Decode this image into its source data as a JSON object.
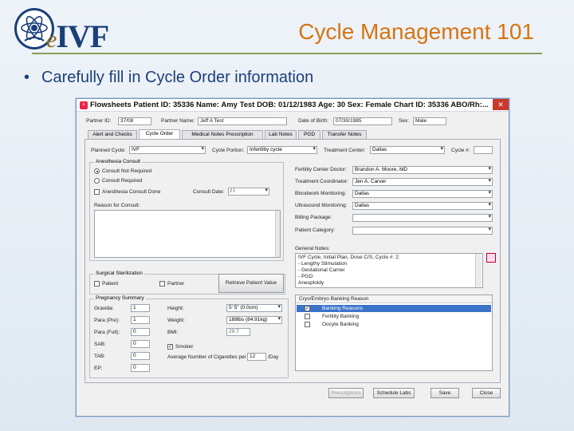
{
  "slide": {
    "logo_text": "IVF",
    "logo_prefix": "e",
    "title": "Cycle Management 101",
    "bullet_symbol": "•",
    "bullet_text": "Carefully fill in Cycle Order information"
  },
  "window": {
    "title": "Flowsheets  Patient ID: 35336  Name: Amy Test  DOB: 01/12/1983  Age: 30  Sex: Female  Chart ID: 35336  ABO/Rh:...",
    "close_glyph": "✕",
    "patient_id_label": "Partner ID:",
    "patient_id_value": "37/08",
    "partner_name_label": "Partner Name:",
    "partner_name_value": "Jeff A Test",
    "dob_label": "Date of Birth:",
    "dob_value": "07/30/1985",
    "sex_label": "Sex:",
    "sex_value": "Male",
    "tabs": [
      "Alert and Checks",
      "Cycle Order",
      "Medical Notes Prescription",
      "Lab Notes",
      "PGD",
      "Transfer Notes"
    ],
    "planned_cycle_label": "Planned Cycle:",
    "planned_cycle_value": "IVF",
    "cycle_portion_label": "Cycle Portion:",
    "cycle_portion_value": "Infertility cycle",
    "treatment_center_label": "Treatment Center:",
    "treatment_center_value": "Dallas",
    "cycle_num_label": "Cycle #:",
    "anesthesia": {
      "title": "Anesthesia Consult",
      "opt1": "Consult Not Required",
      "opt2": "Consult Required",
      "done_label": "Anesthesia Consult Done",
      "consult_date_label": "Consult Date:",
      "consult_date_value": "/ /",
      "reason_label": "Reason for Consult:"
    },
    "right_fields": [
      {
        "label": "Fertility Center Doctor:",
        "value": "Brandon A. Moore, MD"
      },
      {
        "label": "Treatment Coordinator:",
        "value": "Jen A. Carver"
      },
      {
        "label": "Bloodwork Monitoring:",
        "value": "Dallas"
      },
      {
        "label": "Ultrasound Monitoring:",
        "value": "Dallas"
      },
      {
        "label": "Billing Package:",
        "value": ""
      },
      {
        "label": "Patient Category:",
        "value": ""
      }
    ],
    "general_notes_label": "General Notes:",
    "general_notes_lines": [
      "IVF Cycle, Initial Plan, Dose C/S, Cycle #: 2:",
      "- Lengthy Stimulation",
      "- Gestational Carrier",
      "- PGD:",
      "   Aneuploidy"
    ],
    "surgical": {
      "title": "Surgical Sterilization",
      "patient_label": "Patient",
      "partner_label": "Partner",
      "retrieve_button": "Retrieve Patient Value"
    },
    "pregnancy": {
      "title": "Pregnancy Summary",
      "rows": [
        {
          "label": "Gravida:",
          "value": "1"
        },
        {
          "label": "Para (Pre):",
          "value": "1"
        },
        {
          "label": "Para (Full):",
          "value": "0"
        },
        {
          "label": "SAB:",
          "value": "0"
        },
        {
          "label": "TAB:",
          "value": "0"
        },
        {
          "label": "EP:",
          "value": "0"
        }
      ],
      "height_label": "Height:",
      "height_value": "5' 5\" (0.0cm)",
      "weight_label": "Weight:",
      "weight_value": "188lbs (84.91kg)",
      "bmi_label": "BMI:",
      "bmi_value": "29.7",
      "smoker_label": "Smoker",
      "cigs_label": "Average Number of Cigarettes per",
      "cigs_value": "12",
      "cigs_unit": "/Day"
    },
    "cryo": {
      "title": "Cryo/Embryo Banking Reason",
      "items": [
        {
          "label": "Banking Reasons",
          "checked": true,
          "selected": true
        },
        {
          "label": "Fertility Banking",
          "checked": false,
          "selected": false
        },
        {
          "label": "Oocyte Banking",
          "checked": false,
          "selected": false
        }
      ]
    },
    "buttons": {
      "prescriptions": "Prescriptions",
      "schedule_labs": "Schedule Labs",
      "save": "Save",
      "close": "Close"
    }
  }
}
